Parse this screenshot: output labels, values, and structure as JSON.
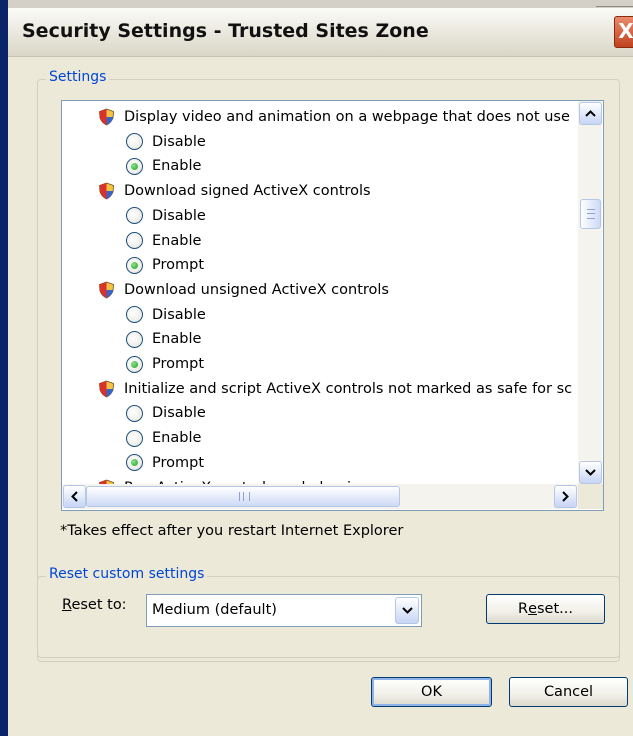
{
  "window": {
    "title": "Security Settings - Trusted Sites Zone",
    "close_glyph": "X"
  },
  "settings": {
    "legend": "Settings",
    "rows": [
      {
        "type": "heading",
        "label": "Display video and animation on a webpage that does not use"
      },
      {
        "type": "option",
        "label": "Disable",
        "checked": false
      },
      {
        "type": "option",
        "label": "Enable",
        "checked": true
      },
      {
        "type": "heading",
        "label": "Download signed ActiveX controls"
      },
      {
        "type": "option",
        "label": "Disable",
        "checked": false
      },
      {
        "type": "option",
        "label": "Enable",
        "checked": false
      },
      {
        "type": "option",
        "label": "Prompt",
        "checked": true
      },
      {
        "type": "heading",
        "label": "Download unsigned ActiveX controls"
      },
      {
        "type": "option",
        "label": "Disable",
        "checked": false
      },
      {
        "type": "option",
        "label": "Enable",
        "checked": false
      },
      {
        "type": "option",
        "label": "Prompt",
        "checked": true
      },
      {
        "type": "heading",
        "label": "Initialize and script ActiveX controls not marked as safe for sc"
      },
      {
        "type": "option",
        "label": "Disable",
        "checked": false
      },
      {
        "type": "option",
        "label": "Enable",
        "checked": false
      },
      {
        "type": "option",
        "label": "Prompt",
        "checked": true
      },
      {
        "type": "heading",
        "label": "Run ActiveX controls and plug-ins"
      }
    ],
    "note": "*Takes effect after you restart Internet Explorer"
  },
  "reset": {
    "legend": "Reset custom settings",
    "label_prefix": "R",
    "label_rest": "eset to:",
    "selected": "Medium (default)",
    "button_prefix": "R",
    "button_underlined": "e",
    "button_rest": "set..."
  },
  "footer": {
    "ok_label": "OK",
    "cancel_label": "Cancel"
  },
  "colors": {
    "legend_blue": "#0046d5",
    "radio_green": "#21a121",
    "dialog_bg": "#ece9d8"
  },
  "icons": {
    "setting": "shield-icon",
    "scroll_up": "chevron-up-icon",
    "scroll_down": "chevron-down-icon",
    "scroll_left": "chevron-left-icon",
    "scroll_right": "chevron-right-icon",
    "dropdown": "chevron-down-icon"
  }
}
